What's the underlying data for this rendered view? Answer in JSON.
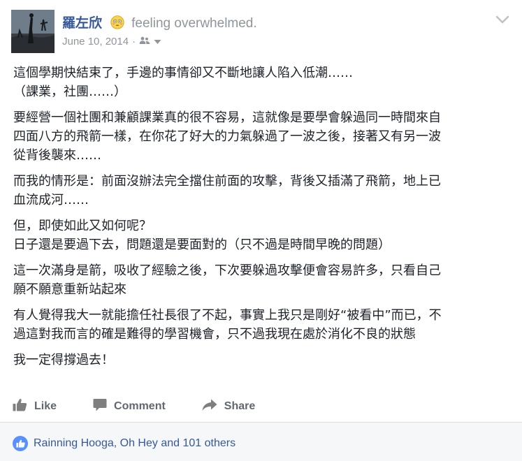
{
  "post": {
    "author": "羅左欣",
    "feeling_text": "feeling overwhelmed.",
    "feeling_icon": "flushed-face-emoji",
    "date": "June 10, 2014",
    "date_separator": "·",
    "privacy_icon": "friends-icon",
    "paragraphs": [
      {
        "lines": [
          "這個學期快結束了，手邊的事情卻又不斷地讓人陷入低潮……",
          "（課業，社團……）"
        ]
      },
      {
        "lines": [
          "要經營一個社團和兼顧課業真的很不容易，這就像是要學會躲過同一時間來自",
          "四面八方的飛箭一樣，在你花了好大的力氣躲過了一波之後，接著又有另一波",
          "從背後襲來……"
        ]
      },
      {
        "lines": [
          "而我的情形是：前面沒辦法完全擋住前面的攻擊，背後又插滿了飛箭，地上已",
          "血流成河……"
        ]
      },
      {
        "lines": [
          "但，即使如此又如何呢？",
          "日子還是要過下去，問題還是要面對的（只不過是時間早晚的問題）"
        ]
      },
      {
        "lines": [
          "這一次滿身是箭，吸收了經驗之後，下次要躲過攻擊便會容易許多，只看自己",
          "願不願意重新站起來"
        ]
      },
      {
        "lines": [
          "有人覺得我大一就能擔任社長很了不起，事實上我只是剛好“被看中”而已，不",
          "過這對我而言的確是難得的學習機會，只不過我現在處於消化不良的狀態"
        ]
      },
      {
        "lines": [
          "我一定得撐過去！"
        ]
      }
    ]
  },
  "actions": {
    "like_label": "Like",
    "comment_label": "Comment",
    "share_label": "Share"
  },
  "reactions": {
    "summary": "Rainning Hooga, Oh Hey and 101 others"
  },
  "colors": {
    "link": "#365899",
    "meta": "#90949c",
    "action": "#616770",
    "like_badge": "#5890ff",
    "footer_bg": "#f6f7f9"
  }
}
